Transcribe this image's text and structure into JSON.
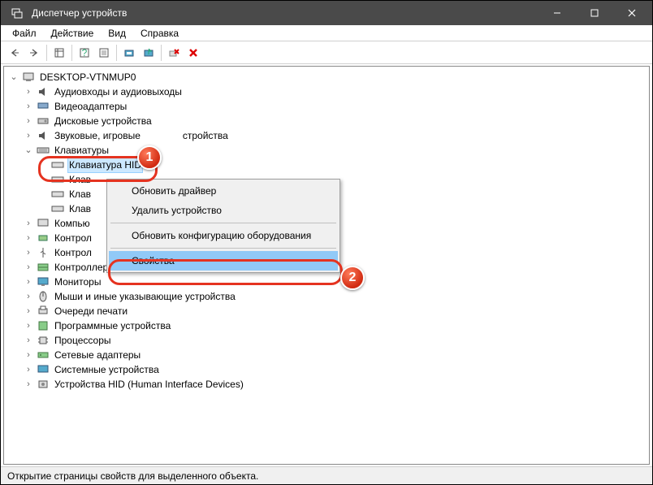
{
  "window": {
    "title": "Диспетчер устройств"
  },
  "menu": {
    "file": "Файл",
    "action": "Действие",
    "view": "Вид",
    "help": "Справка"
  },
  "root": "DESKTOP-VTNMUP0",
  "nodes": {
    "audio": "Аудиовходы и аудиовыходы",
    "video": "Видеоадаптеры",
    "disk": "Дисковые устройства",
    "soundgame": "Звуковые, игровые",
    "soundgame_suffix": "стройства",
    "keyboards": "Клавиатуры",
    "kbd_hid": "Клавиатура HID",
    "kbd_a": "Клав",
    "kbd_b": "Клав",
    "kbd_c": "Клав",
    "computer": "Компью",
    "ctrl_a": "Контрол",
    "ctrl_b": "Контрол",
    "storage_ctrl": "Контроллеры запоминающих устройств",
    "monitors": "Мониторы",
    "mouse": "Мыши и иные указывающие устройства",
    "printq": "Очереди печати",
    "software": "Программные устройства",
    "cpu": "Процессоры",
    "net": "Сетевые адаптеры",
    "system": "Системные устройства",
    "hid": "Устройства HID (Human Interface Devices)"
  },
  "ctx": {
    "update": "Обновить драйвер",
    "remove": "Удалить устройство",
    "rescan": "Обновить конфигурацию оборудования",
    "props": "Свойства"
  },
  "status": "Открытие страницы свойств для выделенного объекта.",
  "badges": {
    "one": "1",
    "two": "2"
  }
}
